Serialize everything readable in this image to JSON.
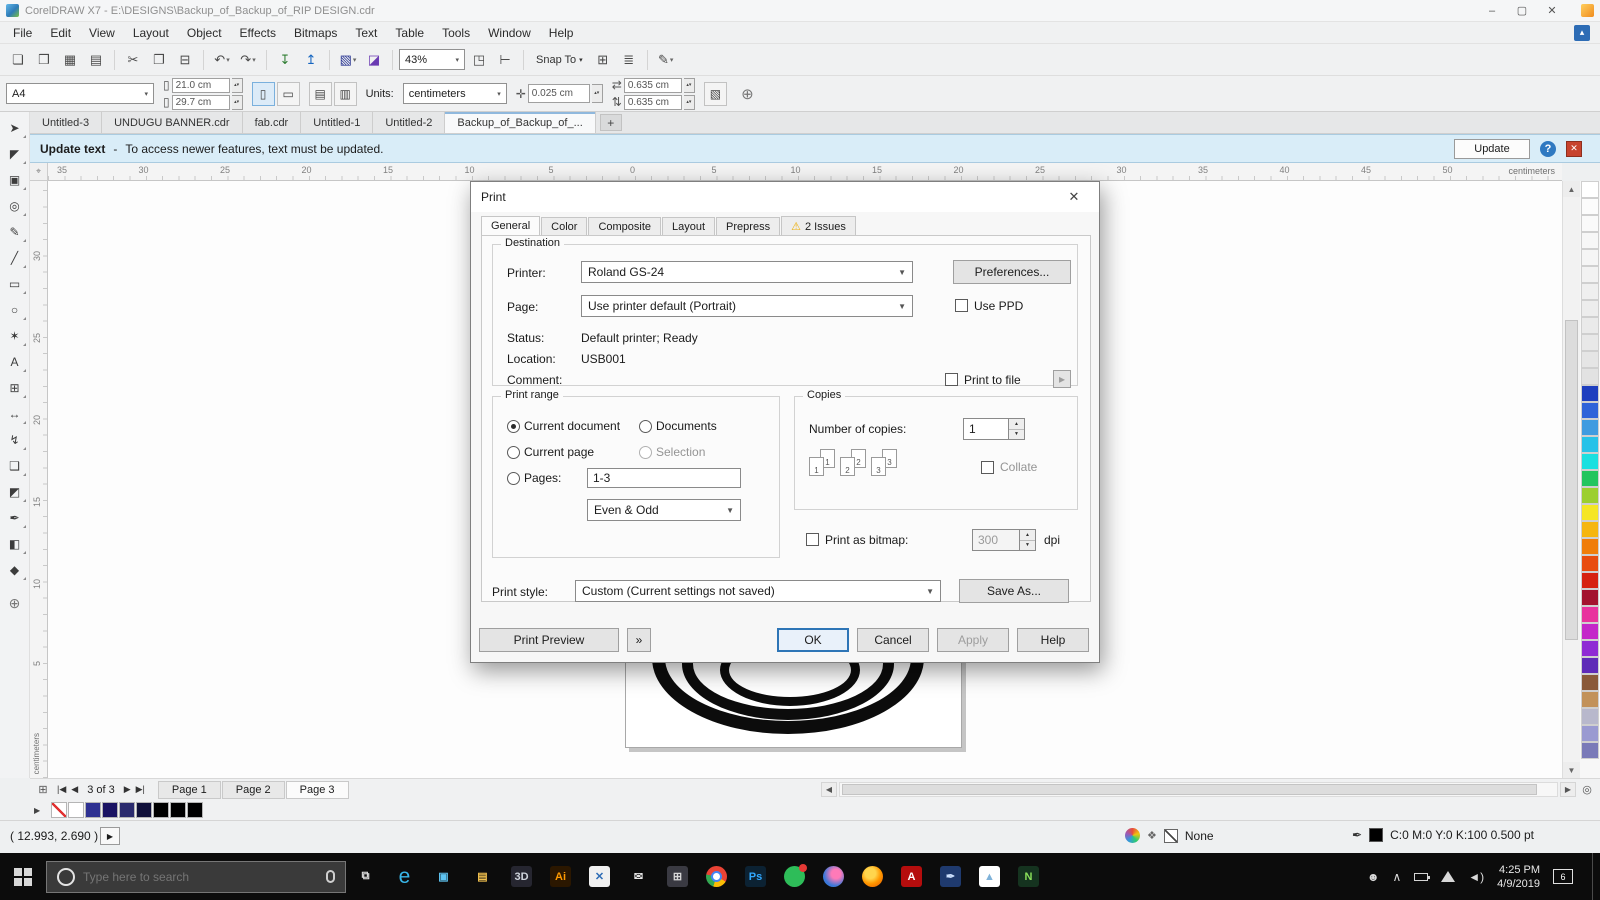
{
  "colors": {
    "accent": "#0078d7",
    "warning": "#edae06",
    "infobar_bg": "#d9edf8",
    "infobar_close_red": "#c7432e"
  },
  "window": {
    "title": "CorelDRAW X7 - E:\\DESIGNS\\Backup_of_Backup_of_RIP DESIGN.cdr",
    "minimize": "–",
    "maximize": "▢",
    "close": "✕"
  },
  "menubar": {
    "items": [
      "File",
      "Edit",
      "View",
      "Layout",
      "Object",
      "Effects",
      "Bitmaps",
      "Text",
      "Table",
      "Tools",
      "Window",
      "Help"
    ]
  },
  "toolbar": {
    "zoom_value": "43%",
    "snap_label": "Snap To",
    "left_icons": [
      {
        "name": "new-document-icon",
        "glyph": "❏"
      },
      {
        "name": "open-icon",
        "glyph": "❒"
      },
      {
        "name": "save-icon",
        "glyph": "▦"
      },
      {
        "name": "print-icon",
        "glyph": "▤"
      },
      {
        "name": "separator"
      },
      {
        "name": "cut-icon",
        "glyph": "✂"
      },
      {
        "name": "copy-icon",
        "glyph": "❐"
      },
      {
        "name": "paste-icon",
        "glyph": "⊟"
      },
      {
        "name": "separator"
      },
      {
        "name": "undo-icon",
        "glyph": "↶",
        "dropdown": true
      },
      {
        "name": "redo-icon",
        "glyph": "↷",
        "dropdown": true
      },
      {
        "name": "separator"
      },
      {
        "name": "import-icon",
        "glyph": "↧",
        "color": "#2e7d32"
      },
      {
        "name": "export-icon",
        "glyph": "↥",
        "color": "#1565c0"
      },
      {
        "name": "separator"
      },
      {
        "name": "application-launcher-icon",
        "glyph": "▧",
        "color": "#283593",
        "dropdown": true
      },
      {
        "name": "corel-connect-icon",
        "glyph": "◪",
        "color": "#6a3ab2"
      },
      {
        "name": "separator"
      }
    ],
    "mid_icons": [
      {
        "name": "full-screen-preview-icon",
        "glyph": "◳"
      },
      {
        "name": "show-rulers-icon",
        "glyph": "⊢"
      },
      {
        "name": "separator"
      }
    ],
    "end_icons": [
      {
        "name": "show-grid-icon",
        "glyph": "⊞"
      },
      {
        "name": "align-guides-icon",
        "glyph": "≣"
      },
      {
        "name": "separator"
      },
      {
        "name": "outline-pen-icon",
        "glyph": "✎",
        "dropdown": true
      }
    ]
  },
  "propbar": {
    "page_preset": "A4",
    "page_width": "21.0 cm",
    "page_height": "29.7 cm",
    "units_label": "Units:",
    "units_value": "centimeters",
    "nudge_value": "0.025 cm",
    "dup_x": "0.635 cm",
    "dup_y": "0.635 cm"
  },
  "doc_tabs": {
    "tabs": [
      "Untitled-3",
      "UNDUGU BANNER.cdr",
      "fab.cdr",
      "Untitled-1",
      "Untitled-2",
      "Backup_of_Backup_of_..."
    ],
    "active_index": 5,
    "add": "+"
  },
  "infobar": {
    "title": "Update text",
    "dash": "-",
    "message": "To access newer features, text must be updated.",
    "update": "Update",
    "help": "?",
    "close": "✕"
  },
  "rulers": {
    "h_numbers": [
      "35",
      "30",
      "25",
      "20",
      "15",
      "10",
      "5",
      "0",
      "5",
      "10",
      "15",
      "20",
      "25",
      "30",
      "35",
      "40",
      "45",
      "50"
    ],
    "v_numbers": [
      "30",
      "25",
      "20",
      "15",
      "10",
      "5"
    ],
    "unit": "centimeters"
  },
  "toolbox": [
    {
      "name": "pick-tool",
      "glyph": "➤"
    },
    {
      "name": "shape-tool",
      "glyph": "◤"
    },
    {
      "name": "crop-tool",
      "glyph": "▣"
    },
    {
      "name": "zoom-tool",
      "glyph": "◎"
    },
    {
      "name": "freehand-tool",
      "glyph": "✎"
    },
    {
      "name": "two-point-line-tool",
      "glyph": "╱"
    },
    {
      "name": "rectangle-tool",
      "glyph": "▭"
    },
    {
      "name": "ellipse-tool",
      "glyph": "○"
    },
    {
      "name": "polygon-tool",
      "glyph": "✶"
    },
    {
      "name": "text-tool",
      "glyph": "A"
    },
    {
      "name": "table-tool",
      "glyph": "⊞"
    },
    {
      "name": "parallel-dimension-tool",
      "glyph": "↔"
    },
    {
      "name": "connector-tool",
      "glyph": "↯"
    },
    {
      "name": "drop-shadow-tool",
      "glyph": "❑"
    },
    {
      "name": "transparency-tool",
      "glyph": "◩"
    },
    {
      "name": "color-eyedropper-tool",
      "glyph": "✒"
    },
    {
      "name": "interactive-fill-tool",
      "glyph": "◧"
    },
    {
      "name": "smart-fill-tool",
      "glyph": "◆"
    },
    {
      "name": "add-tools-button",
      "glyph": "⊕"
    }
  ],
  "palette": {
    "colors": [
      "#ffffff",
      "#fcfcfc",
      "#fafafa",
      "#f7f7f7",
      "#f5f5f5",
      "#f2f2f2",
      "#efefef",
      "#ededed",
      "#eaeaea",
      "#e8e8e8",
      "#e5e5e5",
      "#e2e2e2",
      "#1f3fbf",
      "#2f63d9",
      "#3f9be0",
      "#27c2e8",
      "#19e0e0",
      "#22c55e",
      "#9ccf2f",
      "#f5e625",
      "#f5b60f",
      "#f07d0a",
      "#e84b0f",
      "#d6220f",
      "#a3122e",
      "#e8329e",
      "#c426c9",
      "#8f2bd4",
      "#5f2bb8",
      "#8a5a3a",
      "#c2925a",
      "#b8b8cc",
      "#9a9ad1",
      "#7a7ab8"
    ]
  },
  "print_dialog": {
    "title": "Print",
    "close": "✕",
    "tabs": [
      {
        "label": "General",
        "active": true
      },
      {
        "label": "Color"
      },
      {
        "label": "Composite"
      },
      {
        "label": "Layout"
      },
      {
        "label": "Prepress"
      },
      {
        "label": "2 Issues",
        "warning": true
      }
    ],
    "destination": {
      "legend": "Destination",
      "printer_label": "Printer:",
      "printer_value": "Roland GS-24",
      "preferences_button": "Preferences...",
      "page_label": "Page:",
      "page_value": "Use printer default (Portrait)",
      "use_ppd_label": "Use PPD",
      "status_label": "Status:",
      "status_value": "Default printer; Ready",
      "location_label": "Location:",
      "location_value": "USB001",
      "comment_label": "Comment:",
      "print_to_file_label": "Print to file",
      "expand_glyph": "▸"
    },
    "print_range": {
      "legend": "Print range",
      "current_document": "Current document",
      "documents": "Documents",
      "current_page": "Current page",
      "selection": "Selection",
      "pages_label": "Pages:",
      "pages_value": "1-3",
      "even_odd_value": "Even & Odd"
    },
    "copies": {
      "legend": "Copies",
      "number_label": "Number of copies:",
      "number_value": "1",
      "collate_label": "Collate",
      "collate_pages": [
        "1",
        "2",
        "3"
      ]
    },
    "bitmap": {
      "label": "Print as bitmap:",
      "dpi_value": "300",
      "dpi_unit": "dpi"
    },
    "style": {
      "label": "Print style:",
      "value": "Custom (Current settings not saved)",
      "save_as_button": "Save As..."
    },
    "buttons": {
      "print_preview": "Print Preview",
      "expand": "»",
      "ok": "OK",
      "cancel": "Cancel",
      "apply": "Apply",
      "help": "Help"
    }
  },
  "page_nav": {
    "add_glyph": "⊞",
    "first": "|◀",
    "prev": "◀",
    "status": "3 of 3",
    "next": "▶",
    "last": "▶|",
    "tabs": [
      "Page 1",
      "Page 2",
      "Page 3"
    ],
    "active_index": 2,
    "zoom_glyph": "◎"
  },
  "doc_palette": {
    "colors": [
      "none",
      "#ffffff",
      "#2e3192",
      "#1b1464",
      "#2b2b6e",
      "#10103a",
      "#000000",
      "#000000",
      "#000000"
    ]
  },
  "statusbar": {
    "coords": "( 12.993, 2.690 )",
    "fill_none": "None",
    "outline_text": "C:0 M:0 Y:0 K:100  0.500 pt"
  },
  "taskbar": {
    "search_placeholder": "Type here to search",
    "time": "4:25 PM",
    "date": "4/9/2019",
    "notification_badge": "6",
    "apps": [
      {
        "name": "task-view-icon",
        "glyph": "⧉",
        "fg": "#e0e0e0"
      },
      {
        "name": "edge-icon",
        "glyph": "e",
        "fg": "#38b6e8",
        "big": true
      },
      {
        "name": "store-icon",
        "glyph": "▣",
        "fg": "#5fc4f2"
      },
      {
        "name": "file-explorer-icon",
        "glyph": "▤",
        "fg": "#f2c14e"
      },
      {
        "name": "3dwox-icon",
        "glyph": "3D",
        "fg": "#cfd4dc",
        "bg": "#262630"
      },
      {
        "name": "illustrator-icon",
        "glyph": "Ai",
        "fg": "#ff9a00",
        "bg": "#2b1700"
      },
      {
        "name": "coreldraw-icon",
        "glyph": "✕",
        "fg": "#2d6cb5",
        "bg": "#f0f0f0"
      },
      {
        "name": "mail-icon",
        "glyph": "✉",
        "fg": "#e8e8e8"
      },
      {
        "name": "calculator-icon",
        "glyph": "⊞",
        "fg": "#d8d8d8",
        "bg": "#3a3a42"
      },
      {
        "name": "chrome-icon",
        "cls": "chrome"
      },
      {
        "name": "photoshop-icon",
        "glyph": "Ps",
        "fg": "#31a8ff",
        "bg": "#0c2233"
      },
      {
        "name": "app-icon-green-badge",
        "cls": "green-dot"
      },
      {
        "name": "app-icon-blue-round",
        "cls": "blue-round"
      },
      {
        "name": "firefox-icon",
        "glyph": "",
        "cls": "firefox"
      },
      {
        "name": "acrobat-icon",
        "glyph": "A",
        "fg": "#ffffff",
        "bg": "#b50d0d"
      },
      {
        "name": "app-icon-pen-blue",
        "glyph": "✒",
        "fg": "#cfe2ff",
        "bg": "#1f3a6e"
      },
      {
        "name": "photos-icon",
        "glyph": "▲",
        "fg": "#7fb2d9",
        "bg": "#ffffff"
      },
      {
        "name": "app-icon-green",
        "glyph": "N",
        "fg": "#8ae05a",
        "bg": "#15331f"
      }
    ]
  }
}
